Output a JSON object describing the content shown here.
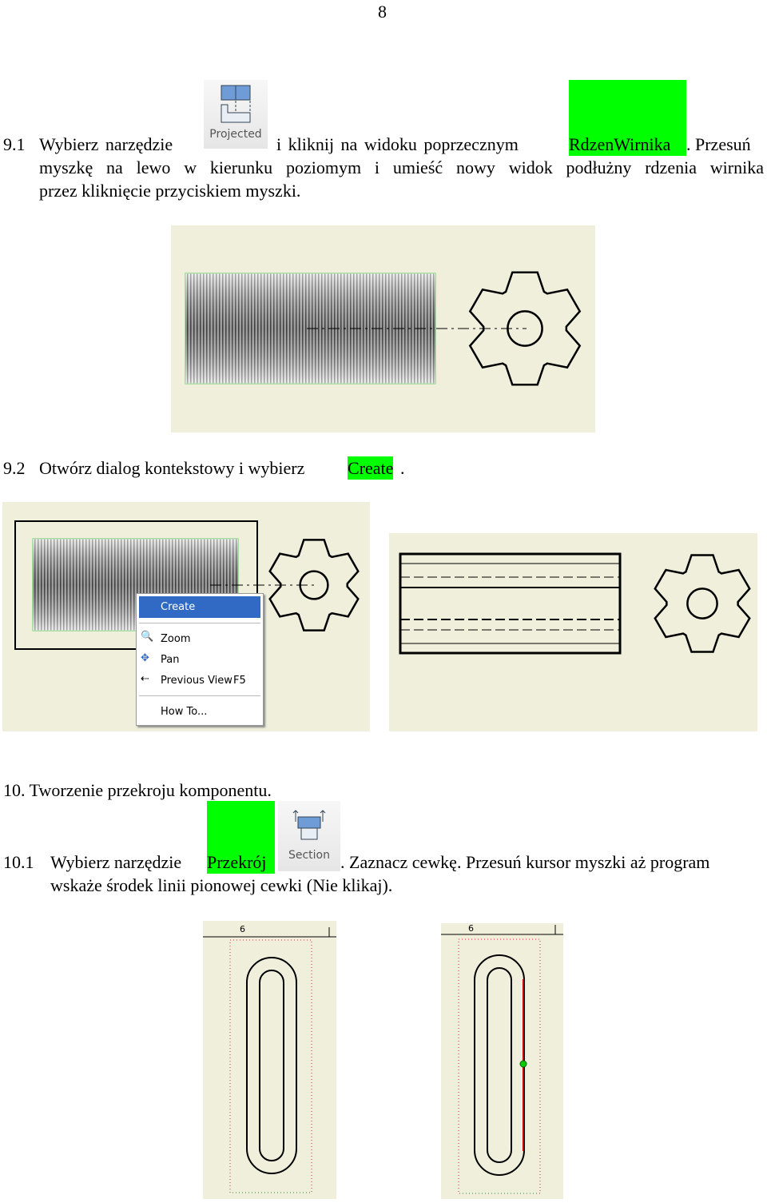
{
  "page_number": "8",
  "s91": {
    "num": "9.1",
    "pre": "Wybierz narzędzie",
    "tool": "Projected",
    "mid": "i kliknij na widoku poprzecznym",
    "highlight": "RdzenWirnika",
    "post": ". Przesuń",
    "line2": "myszkę na lewo w kierunku poziomym i umieść nowy widok podłużny rdzenia wirnika",
    "line3": "przez kliknięcie przyciskiem myszki."
  },
  "s92": {
    "num": "9.2",
    "pre": "Otwórz dialog kontekstowy i wybierz",
    "highlight": "Create",
    "post": "."
  },
  "menu": {
    "items": [
      "Create",
      "Zoom",
      "Pan",
      "Previous View",
      "How To..."
    ],
    "shortcut": "F5"
  },
  "s10": {
    "heading": "10. Tworzenie przekroju komponentu."
  },
  "s101": {
    "num": "10.1",
    "pre": "Wybierz narzędzie",
    "highlight": "Przekrój",
    "tool": "Section",
    "post": ". Zaznacz cewkę. Przesuń kursor myszki aż program",
    "line2": "wskaże środek linii pionowej cewki (Nie klikaj)."
  },
  "drawings": {
    "dim_label": "6"
  },
  "colors": {
    "highlight": "#00ff00",
    "drawing_bg": "#efefdc",
    "menu_selected": "#316ac5"
  }
}
